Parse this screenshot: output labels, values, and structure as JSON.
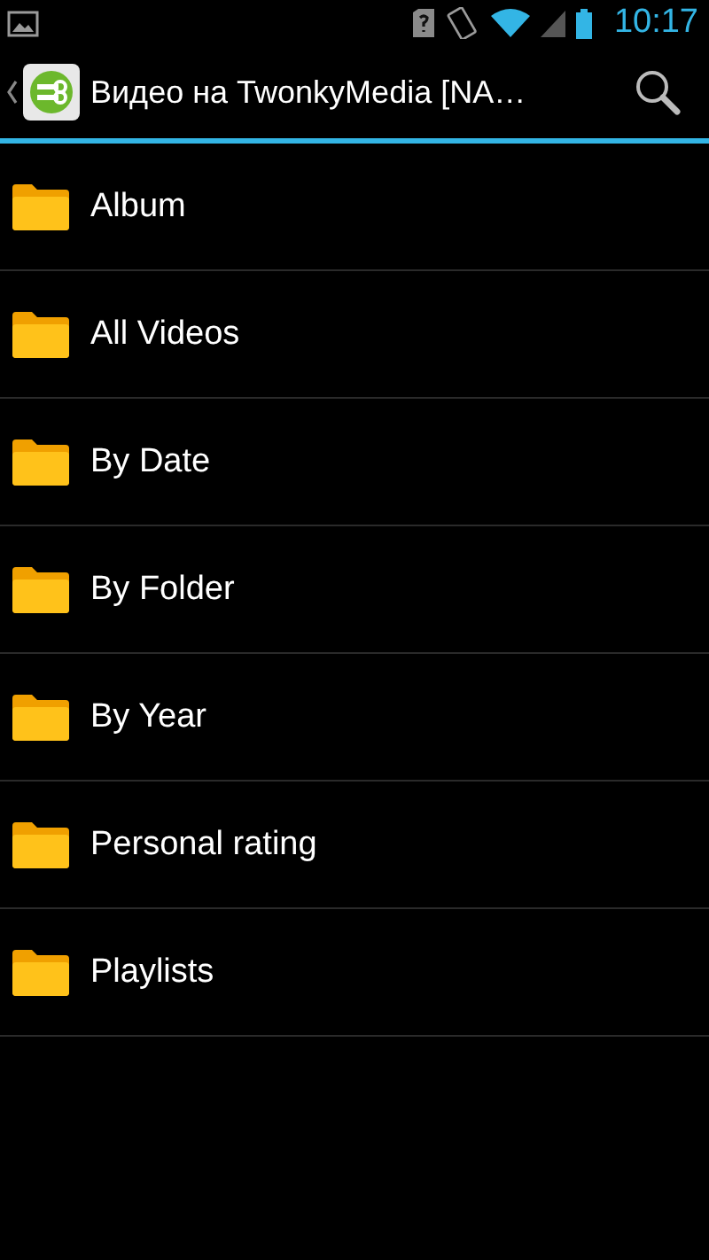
{
  "status_bar": {
    "time": "10:17"
  },
  "action_bar": {
    "title": "Видео на TwonkyMedia [NA…"
  },
  "folders": [
    {
      "label": "Album"
    },
    {
      "label": "All Videos"
    },
    {
      "label": "By Date"
    },
    {
      "label": "By Folder"
    },
    {
      "label": "By Year"
    },
    {
      "label": "Personal rating"
    },
    {
      "label": "Playlists"
    }
  ]
}
